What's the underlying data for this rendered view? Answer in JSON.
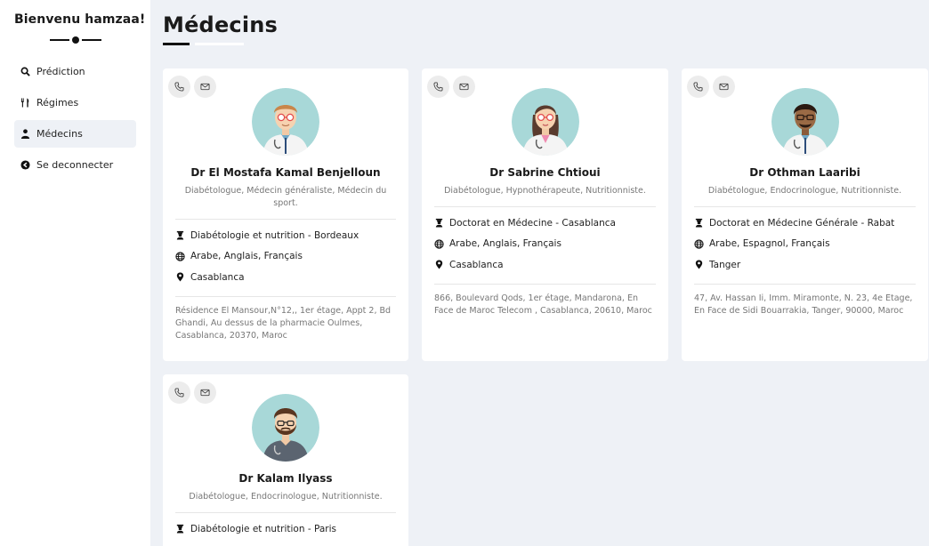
{
  "sidebar": {
    "welcome": "Bienvenu hamzaa!",
    "items": [
      {
        "label": "Prédiction",
        "icon": "search-icon"
      },
      {
        "label": "Régimes",
        "icon": "utensils-icon"
      },
      {
        "label": "Médecins",
        "icon": "doctor-icon",
        "active": true
      },
      {
        "label": "Se deconnecter",
        "icon": "logout-icon"
      }
    ]
  },
  "page": {
    "title": "Médecins"
  },
  "doctors": [
    {
      "name": "Dr El Mostafa Kamal Benjelloun",
      "specialties": "Diabétologue, Médecin généraliste, Médecin du sport.",
      "education": "Diabétologie et nutrition - Bordeaux",
      "languages": "Arabe, Anglais, Français",
      "city": "Casablanca",
      "address": "Résidence El Mansour,N°12,, 1er étage, Appt 2, Bd Ghandi, Au dessus de la pharmacie Oulmes, Casablanca, 20370, Maroc",
      "avatar": "male-doctor-glasses"
    },
    {
      "name": "Dr Sabrine Chtioui",
      "specialties": "Diabétologue, Hypnothérapeute, Nutritionniste.",
      "education": "Doctorat en Médecine - Casablanca",
      "languages": "Arabe, Anglais, Français",
      "city": "Casablanca",
      "address": "866, Boulevard Qods, 1er étage, Mandarona, En Face de Maroc Telecom , Casablanca, 20610, Maroc",
      "avatar": "female-doctor"
    },
    {
      "name": "Dr Othman Laaribi",
      "specialties": "Diabétologue, Endocrinologue, Nutritionniste.",
      "education": "Doctorat en Médecine Générale - Rabat",
      "languages": "Arabe, Espagnol, Français",
      "city": "Tanger",
      "address": "47, Av. Hassan Ii, Imm. Miramonte, N. 23, 4e Etage, En Face de Sidi Bouarrakia, Tanger, 90000, Maroc",
      "avatar": "male-doctor-dark"
    },
    {
      "name": "Dr Kalam Ilyass",
      "specialties": "Diabétologue, Endocrinologue, Nutritionniste.",
      "education": "Diabétologie et nutrition - Paris",
      "avatar": "male-doctor-beard"
    }
  ],
  "colors": {
    "background": "#eef1f6",
    "card": "#ffffff",
    "avatar_bg": "#a8d8d8"
  }
}
